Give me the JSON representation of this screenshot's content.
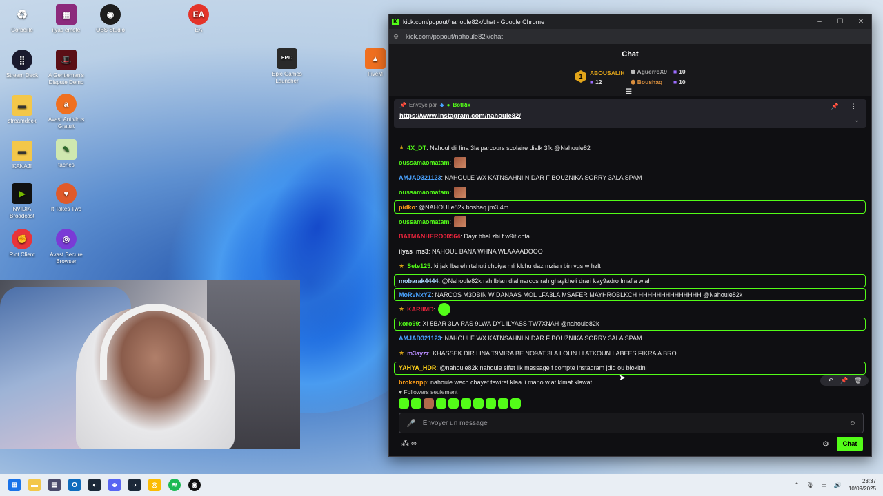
{
  "desktop": {
    "icons": [
      {
        "label": "Corbeille",
        "icon": "recycle-bin-icon"
      },
      {
        "label": "ilyas emote",
        "icon": "archive-icon"
      },
      {
        "label": "OBS Studio",
        "icon": "obs-icon"
      },
      {
        "label": "EA",
        "icon": "ea-icon"
      },
      {
        "label": "Stream Deck",
        "icon": "stream-deck-icon"
      },
      {
        "label": "A Gentleman's Dispute Demo",
        "icon": "hat-icon"
      },
      {
        "label": "Epic Games Launcher",
        "icon": "epic-games-icon"
      },
      {
        "label": "FiveM",
        "icon": "fivem-icon"
      },
      {
        "label": "streamdeck",
        "icon": "folder-icon"
      },
      {
        "label": "Avast Antivirus Gratuit",
        "icon": "avast-icon"
      },
      {
        "label": "KANAJI",
        "icon": "folder-icon"
      },
      {
        "label": "taches",
        "icon": "notepad-icon"
      },
      {
        "label": "NVIDIA Broadcast",
        "icon": "nvidia-icon"
      },
      {
        "label": "It Takes Two",
        "icon": "it-takes-two-icon"
      },
      {
        "label": "Riot Client",
        "icon": "riot-icon"
      },
      {
        "label": "Avast Secure Browser",
        "icon": "avast-browser-icon"
      }
    ]
  },
  "window": {
    "title": "kick.com/popout/nahoule82k/chat - Google Chrome",
    "url": "kick.com/popout/nahoule82k/chat",
    "controls": {
      "minimize": "–",
      "maximize": "☐",
      "close": "✕"
    }
  },
  "chat": {
    "header": "Chat",
    "leaderboard": [
      {
        "rank": "1",
        "name": "ABOUSALIH",
        "count": "12"
      },
      {
        "rank": "2",
        "name": "AguerroX9",
        "count": "10"
      },
      {
        "rank": "3",
        "name": "Boushaq",
        "count": "10"
      }
    ],
    "pinned": {
      "sent_by_label": "Envoyé par",
      "sender": "BotRix",
      "link": "https://www.instagram.com/nahoule82/"
    },
    "messages": [
      {
        "user": "4X_DT",
        "color": "#53fc18",
        "text": ": Nahoul dii lina 3la parcours scolaire dialk 3fk @Nahoule82",
        "hl": false,
        "badge": true
      },
      {
        "user": "oussamaomatam",
        "color": "#53fc18",
        "text": ":",
        "hl": false,
        "emote": true
      },
      {
        "user": "AMJAD321123",
        "color": "#4aa3ff",
        "text": ": NAHOULE WX KATNSAHNI N DAR F BOUZNIKA SORRY 3ALA SPAM",
        "hl": false
      },
      {
        "user": "oussamaomatam",
        "color": "#53fc18",
        "text": ":",
        "hl": false,
        "emote": true
      },
      {
        "user": "pidko",
        "color": "#ff9f1a",
        "text": ": @NAHOULe82k boshaq jm3 4m",
        "hl": true
      },
      {
        "user": "oussamaomatam",
        "color": "#53fc18",
        "text": ":",
        "hl": false,
        "emote": true
      },
      {
        "user": "BATMANHERO00564",
        "color": "#e8243c",
        "text": ": Dayr bhal zbi f w9it chta",
        "hl": false
      },
      {
        "user": "ilyas_ms3",
        "color": "#e6e6e6",
        "text": ": NAHOUL BANA WHNA WLAAAADOOO",
        "hl": false
      },
      {
        "user": "Sete125",
        "color": "#53fc18",
        "text": ": ki jak lbareh rtahuti choiya mli klchu daz mzian bin vgs w hzlt",
        "hl": false,
        "badge": true
      },
      {
        "user": "mobarak4444",
        "color": "#a9d6ff",
        "text": ": @Nahoule82k rah lblan dial narcos rah ghaykheli drari kay9adro lmafia wlah",
        "hl": true
      },
      {
        "user": "MoRvNxYZ",
        "color": "#4aa3ff",
        "text": ": NARCOS M3DBIN W DANAAS MOL LFA3LA MSAFER MAYHROBLKCH HHHHHHHHHHHHHH @Nahoule82k",
        "hl": true
      },
      {
        "user": "KARIIMD",
        "color": "#e8243c",
        "text": ":",
        "hl": false,
        "badge": true,
        "round": true
      },
      {
        "user": "koro99",
        "color": "#53fc18",
        "text": ": XI 5BAR 3LA RAS 9LWA DYL ILYASS TW7XNAH @nahoule82k",
        "hl": true
      },
      {
        "user": "AMJAD321123",
        "color": "#4aa3ff",
        "text": ": NAHOULE WX KATNSAHNI N DAR F BOUZNIKA SORRY 3ALA SPAM",
        "hl": false
      },
      {
        "user": "m3ayzz",
        "color": "#b98cff",
        "text": ": KHASSEK DIR LINA T9MIRA BE NO9AT 3LA LOUN LI ATKOUN LABEES FIKRA A BRO",
        "hl": false,
        "badge": true
      },
      {
        "user": "YAHYA_HDR",
        "color": "#ffd21a",
        "text": ": @nahoule82k nahoule sifet lik message f compte Instagram jdid ou blokitini",
        "hl": true
      },
      {
        "user": "brokenpp",
        "color": "#ff9f1a",
        "text": ": nahoule wech chayef tswiret klaa li mano wlat klmat klawat",
        "hl": false,
        "actions": true
      }
    ],
    "followers_only": "Followers seulement",
    "input_placeholder": "Envoyer un message",
    "send_button": "Chat"
  },
  "taskbar": {
    "time": "23:37",
    "date": "10/09/2025"
  }
}
